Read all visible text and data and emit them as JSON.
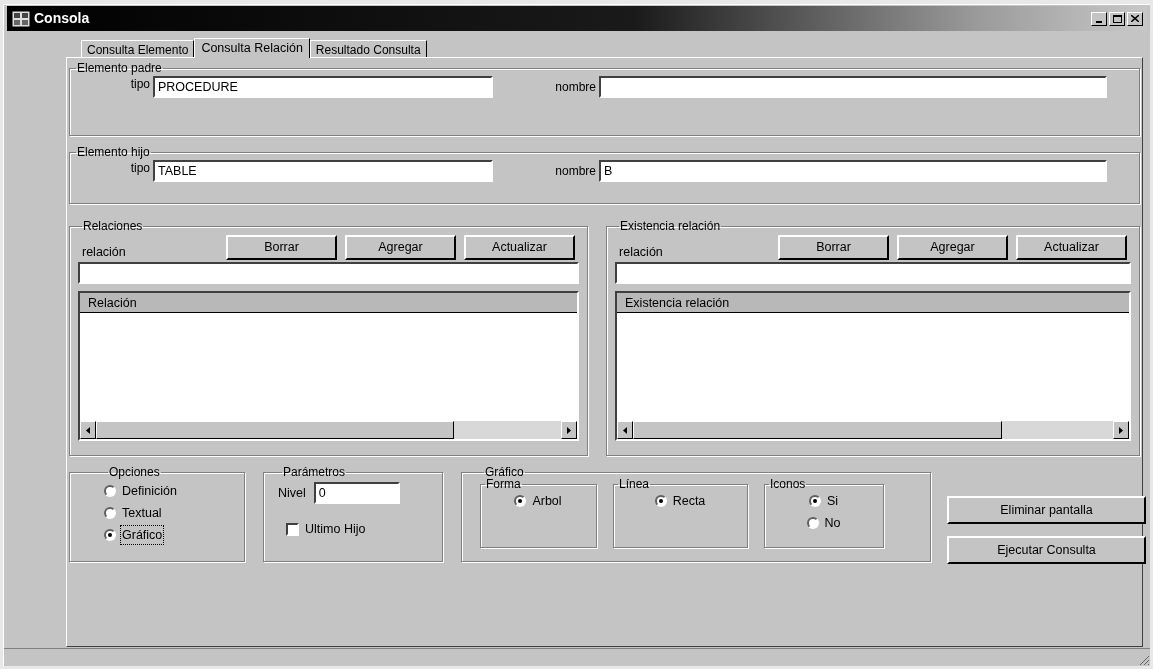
{
  "window": {
    "title": "Consola"
  },
  "tabs": [
    {
      "label": "Consulta Elemento",
      "selected": false
    },
    {
      "label": "Consulta Relación",
      "selected": true
    },
    {
      "label": "Resultado Consulta",
      "selected": false
    }
  ],
  "element_groups": [
    {
      "legend": "Elemento padre",
      "fields": [
        {
          "label": "tipo",
          "value": "PROCEDURE"
        },
        {
          "label": "nombre"
        }
      ]
    },
    {
      "legend": "Elemento hijo",
      "fields": [
        {
          "label": "tipo",
          "value": "TABLE"
        },
        {
          "label": "nombre",
          "value": "B"
        }
      ]
    }
  ],
  "relation_panels": [
    {
      "legend": "Relaciones",
      "field_label": "relación",
      "buttons": [
        "Borrar",
        "Agregar",
        "Actualizar"
      ],
      "column": "Relación"
    },
    {
      "legend": "Existencia relación",
      "field_label": "relación",
      "buttons": [
        "Borrar",
        "Agregar",
        "Actualizar"
      ],
      "column": "Existencia relación"
    }
  ],
  "options": {
    "legend": "Opciones",
    "radios": [
      {
        "label": "Definición",
        "selected": false,
        "focused": false
      },
      {
        "label": "Textual",
        "selected": false,
        "focused": false
      },
      {
        "label": "Gráfico",
        "selected": true,
        "focused": true
      }
    ]
  },
  "parameters": {
    "legend": "Parámetros",
    "level_label": "Nivel",
    "level_value": "0",
    "checkbox": {
      "label": "Ultimo Hijo",
      "checked": false
    }
  },
  "graphic": {
    "legend": "Gráfico",
    "groups": [
      {
        "legend": "Forma",
        "radios": [
          {
            "label": "Arbol",
            "selected": true
          }
        ]
      },
      {
        "legend": "Línea",
        "radios": [
          {
            "label": "Recta",
            "selected": true
          }
        ]
      },
      {
        "legend": "Iconos",
        "radios": [
          {
            "label": "Si",
            "selected": true
          },
          {
            "label": "No",
            "selected": false
          }
        ]
      }
    ]
  },
  "actions": [
    "Eliminar pantalla",
    "Ejecutar Consulta"
  ]
}
